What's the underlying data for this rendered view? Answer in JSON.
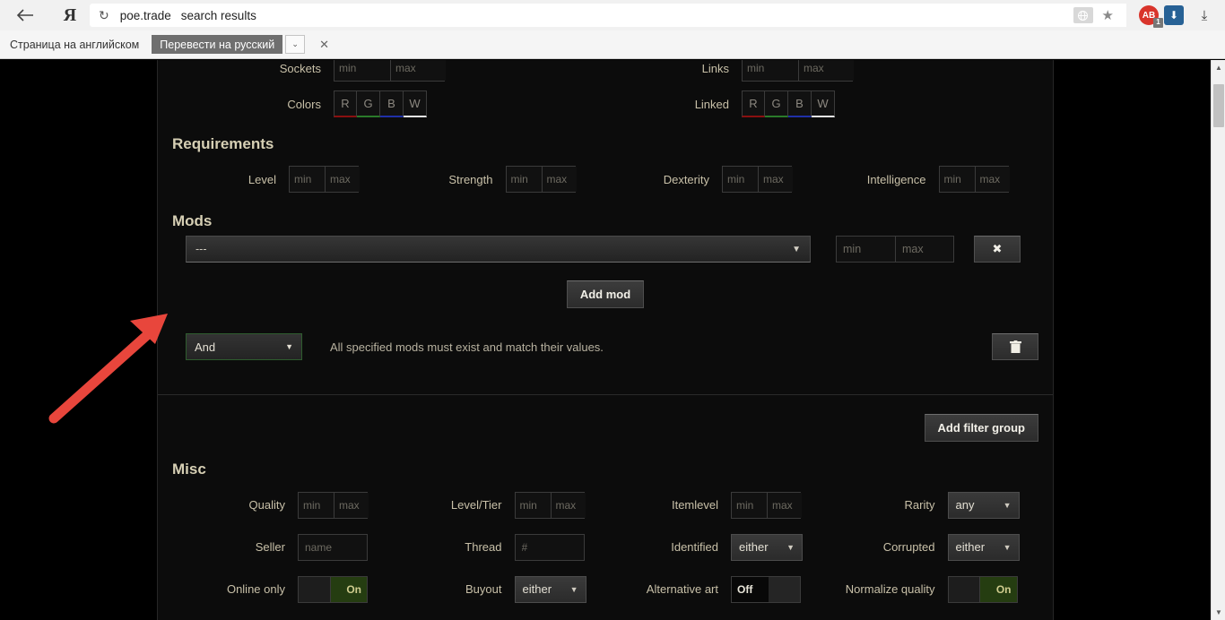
{
  "browser": {
    "back_icon": "back-arrow",
    "brand_logo": "Я",
    "reload_icon": "↻",
    "url_domain": "poe.trade",
    "url_title": "search results",
    "omnibox_badge_icon": "globe-icon",
    "star_icon": "★",
    "adblock_label": "AB",
    "adblock_count": "1",
    "download_ext_icon": "⬇",
    "download_tray_icon": "⤓"
  },
  "translate_bar": {
    "message": "Страница на английском",
    "translate_button": "Перевести на русский",
    "caret": "⌄",
    "close": "✕"
  },
  "sockets": {
    "sockets_label": "Sockets",
    "links_label": "Links",
    "colors_label": "Colors",
    "linked_label": "Linked",
    "min_placeholder": "min",
    "max_placeholder": "max",
    "color_buttons": [
      "R",
      "G",
      "B",
      "W"
    ]
  },
  "requirements": {
    "heading": "Requirements",
    "fields": [
      {
        "label": "Level",
        "min": "min",
        "max": "max"
      },
      {
        "label": "Strength",
        "min": "min",
        "max": "max"
      },
      {
        "label": "Dexterity",
        "min": "min",
        "max": "max"
      },
      {
        "label": "Intelligence",
        "min": "min",
        "max": "max"
      }
    ]
  },
  "mods": {
    "heading": "Mods",
    "mod_select_value": "---",
    "caret": "▼",
    "min_placeholder": "min",
    "max_placeholder": "max",
    "remove_icon": "✖",
    "add_mod_button": "Add mod",
    "match_select_value": "And",
    "match_description": "All specified mods must exist and match their values.",
    "delete_group_icon": "🗑",
    "add_filter_group_button": "Add filter group"
  },
  "misc": {
    "heading": "Misc",
    "rows": [
      [
        {
          "label": "Quality",
          "type": "minmax",
          "min": "min",
          "max": "max"
        },
        {
          "label": "Level/Tier",
          "type": "minmax",
          "min": "min",
          "max": "max"
        },
        {
          "label": "Itemlevel",
          "type": "minmax",
          "min": "min",
          "max": "max"
        },
        {
          "label": "Rarity",
          "type": "select",
          "value": "any"
        }
      ],
      [
        {
          "label": "Seller",
          "type": "text",
          "placeholder": "name"
        },
        {
          "label": "Thread",
          "type": "text",
          "placeholder": "#"
        },
        {
          "label": "Identified",
          "type": "select",
          "value": "either"
        },
        {
          "label": "Corrupted",
          "type": "select",
          "value": "either"
        }
      ],
      [
        {
          "label": "Online only",
          "type": "toggle-on",
          "value": "On"
        },
        {
          "label": "Buyout",
          "type": "select",
          "value": "either"
        },
        {
          "label": "Alternative art",
          "type": "toggle-off",
          "value": "Off"
        },
        {
          "label": "Normalize quality",
          "type": "toggle-on",
          "value": "On"
        }
      ]
    ]
  },
  "annotation": {
    "arrow_color": "#e8463c"
  },
  "scrollbar": {
    "up": "▲",
    "down": "▼"
  }
}
